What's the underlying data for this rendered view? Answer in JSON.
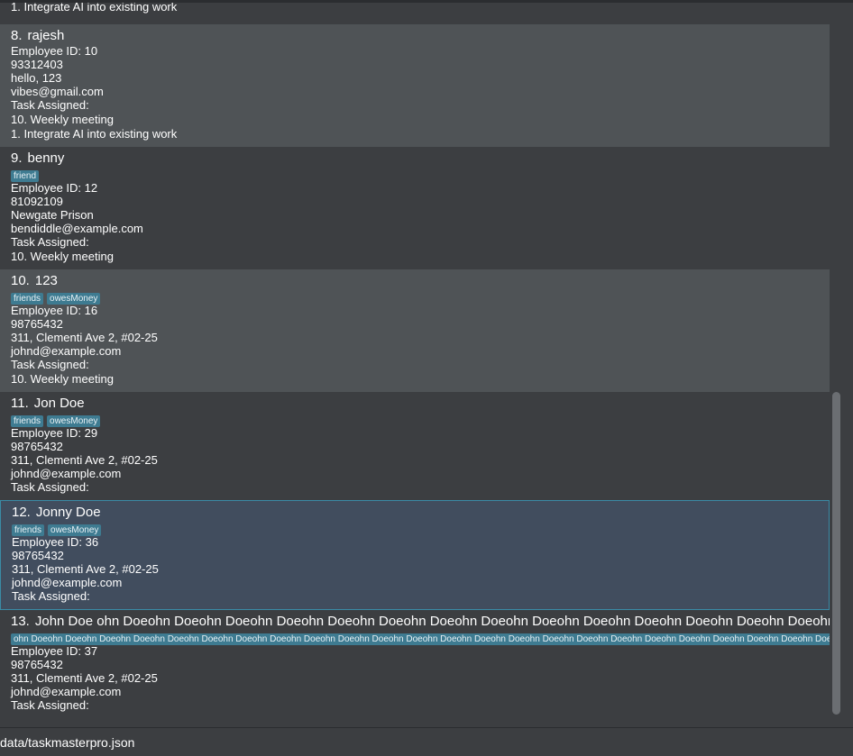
{
  "partial_line": "1. Integrate AI into existing work",
  "persons": [
    {
      "index": "8.",
      "name": "rajesh",
      "tags": [],
      "lines": [
        "Employee ID: 10",
        "93312403",
        "hello, 123",
        "vibes@gmail.com",
        "Task Assigned:",
        "10. Weekly meeting",
        "1. Integrate AI into existing work"
      ]
    },
    {
      "index": "9.",
      "name": "benny",
      "tags": [
        "friend"
      ],
      "lines": [
        "Employee ID: 12",
        "81092109",
        "Newgate Prison",
        "bendiddle@example.com",
        "Task Assigned:",
        "10. Weekly meeting"
      ]
    },
    {
      "index": "10.",
      "name": "123",
      "tags": [
        "friends",
        "owesMoney"
      ],
      "lines": [
        "Employee ID: 16",
        "98765432",
        "311, Clementi Ave 2, #02-25",
        "johnd@example.com",
        "Task Assigned:",
        "10. Weekly meeting"
      ]
    },
    {
      "index": "11.",
      "name": "Jon Doe",
      "tags": [
        "friends",
        "owesMoney"
      ],
      "lines": [
        "Employee ID: 29",
        "98765432",
        "311, Clementi Ave 2, #02-25",
        "johnd@example.com",
        "Task Assigned:"
      ]
    },
    {
      "index": "12.",
      "name": "Jonny Doe",
      "tags": [
        "friends",
        "owesMoney"
      ],
      "lines": [
        "Employee ID: 36",
        "98765432",
        "311, Clementi Ave 2, #02-25",
        "johnd@example.com",
        "Task Assigned:"
      ]
    },
    {
      "index": "13.",
      "name": "John Doe ohn Doeohn Doeohn Doeohn Doeohn Doeohn Doeohn Doeohn Doeohn Doeohn Doeohn Doeohn Doeohn Doeohn Doeohn Doeohn Doeohn Doeohn Doeohn",
      "tags": [
        "ohn Doeohn Doeohn Doeohn Doeohn Doeohn Doeohn Doeohn Doeohn Doeohn Doeohn Doeohn Doeohn Doeohn Doeohn Doeohn Doeohn Doeohn Doeohn Doeohn Doeohn Doeohn Doeohn Doeohn Doeohn Doeohn Doeohn"
      ],
      "lines": [
        "Employee ID: 37",
        "98765432",
        "311, Clementi Ave 2, #02-25",
        "johnd@example.com",
        "Task Assigned:"
      ]
    }
  ],
  "status_bar": {
    "path": "data/taskmasterpro.json"
  },
  "colors": {
    "background": "#3c3e41",
    "card_light": "#4f5356",
    "selected_card": "#414d5e",
    "selected_border": "#3a8ba6",
    "tag": "#3e7b91"
  }
}
